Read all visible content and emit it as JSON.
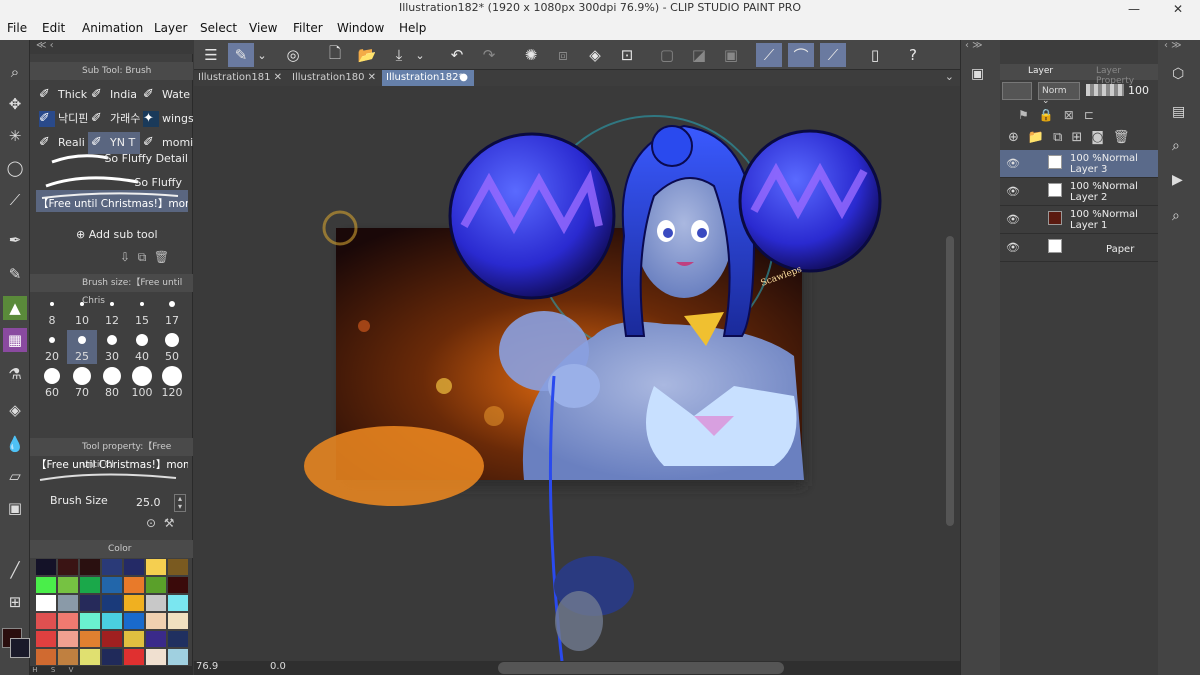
{
  "window": {
    "title": "Illustration182* (1920 x 1080px 300dpi 76.9%) - CLIP STUDIO PAINT PRO",
    "minimize": "—",
    "close": "✕"
  },
  "menu": [
    "File",
    "Edit",
    "Animation",
    "Layer",
    "Select",
    "View",
    "Filter",
    "Window",
    "Help"
  ],
  "tabs": [
    {
      "label": "Illustration181",
      "close": "✕"
    },
    {
      "label": "Illustration180",
      "close": "✕"
    },
    {
      "label": "Illustration182*",
      "close": "●"
    }
  ],
  "sub_tool": {
    "header": "Sub Tool: Brush",
    "brushes": [
      [
        "Thick",
        "India",
        "Wate"
      ],
      [
        "낙디핀",
        "가래수",
        "wings"
      ],
      [
        "Reali",
        "YN T",
        "momi"
      ]
    ],
    "strokes": [
      "So Fluffy Detail",
      "So Fluffy",
      "【Free until Christmas!】momir"
    ],
    "add_sub_tool": "Add sub tool"
  },
  "brush_size": {
    "header": "Brush size:【Free until Chris",
    "sizes": [
      "8",
      "10",
      "12",
      "15",
      "17",
      "20",
      "25",
      "30",
      "40",
      "50",
      "60",
      "70",
      "80",
      "100",
      "120"
    ]
  },
  "tool_property": {
    "header": "Tool property:【Free until Cl",
    "brush_name": "【Free until Christmas!】momiri",
    "size_label": "Brush Size",
    "size_value": "25.0"
  },
  "color": {
    "header": "Color",
    "swatches": [
      "#141228",
      "#3a1414",
      "#2a1010",
      "#2a3a78",
      "#242a66",
      "#f5cf50",
      "#7a5a20",
      "#4aee4a",
      "#76c242",
      "#1aa84a",
      "#2266aa",
      "#e87a2a",
      "#5aa02a",
      "#3a0a0a",
      "#ffffff",
      "#8a9aa8",
      "#262a5a",
      "#1a3a7a",
      "#f0b020",
      "#c8c8c8",
      "#7ae6f0",
      "#e05050",
      "#f07a70",
      "#6af0d0",
      "#4ad0e0",
      "#1a6acc",
      "#f0d0b0",
      "#f0e0c0",
      "#e04040",
      "#f0a090",
      "#e08030",
      "#a02020",
      "#e0c040",
      "#3a2a8a",
      "#203060",
      "#d06a30",
      "#c08040",
      "#e0e070",
      "#202a5a",
      "#e03030",
      "#f0e0d0",
      "#a0d0e0"
    ]
  },
  "layers": {
    "tab_layer": "Layer",
    "tab_property": "Layer Property",
    "blend_mode": "Norm",
    "opacity": "100",
    "items": [
      {
        "pct": "100 %",
        "mode": "Normal",
        "name": "Layer 3",
        "selected": true
      },
      {
        "pct": "100 %",
        "mode": "Normal",
        "name": "Layer 2",
        "selected": false
      },
      {
        "pct": "100 %",
        "mode": "Normal",
        "name": "Layer 1",
        "selected": false
      },
      {
        "pct": "",
        "mode": "",
        "name": "Paper",
        "selected": false
      }
    ]
  },
  "status": {
    "zoom": "76.9",
    "angle": "0.0"
  },
  "artwork": {
    "signature": "Scawleps"
  }
}
